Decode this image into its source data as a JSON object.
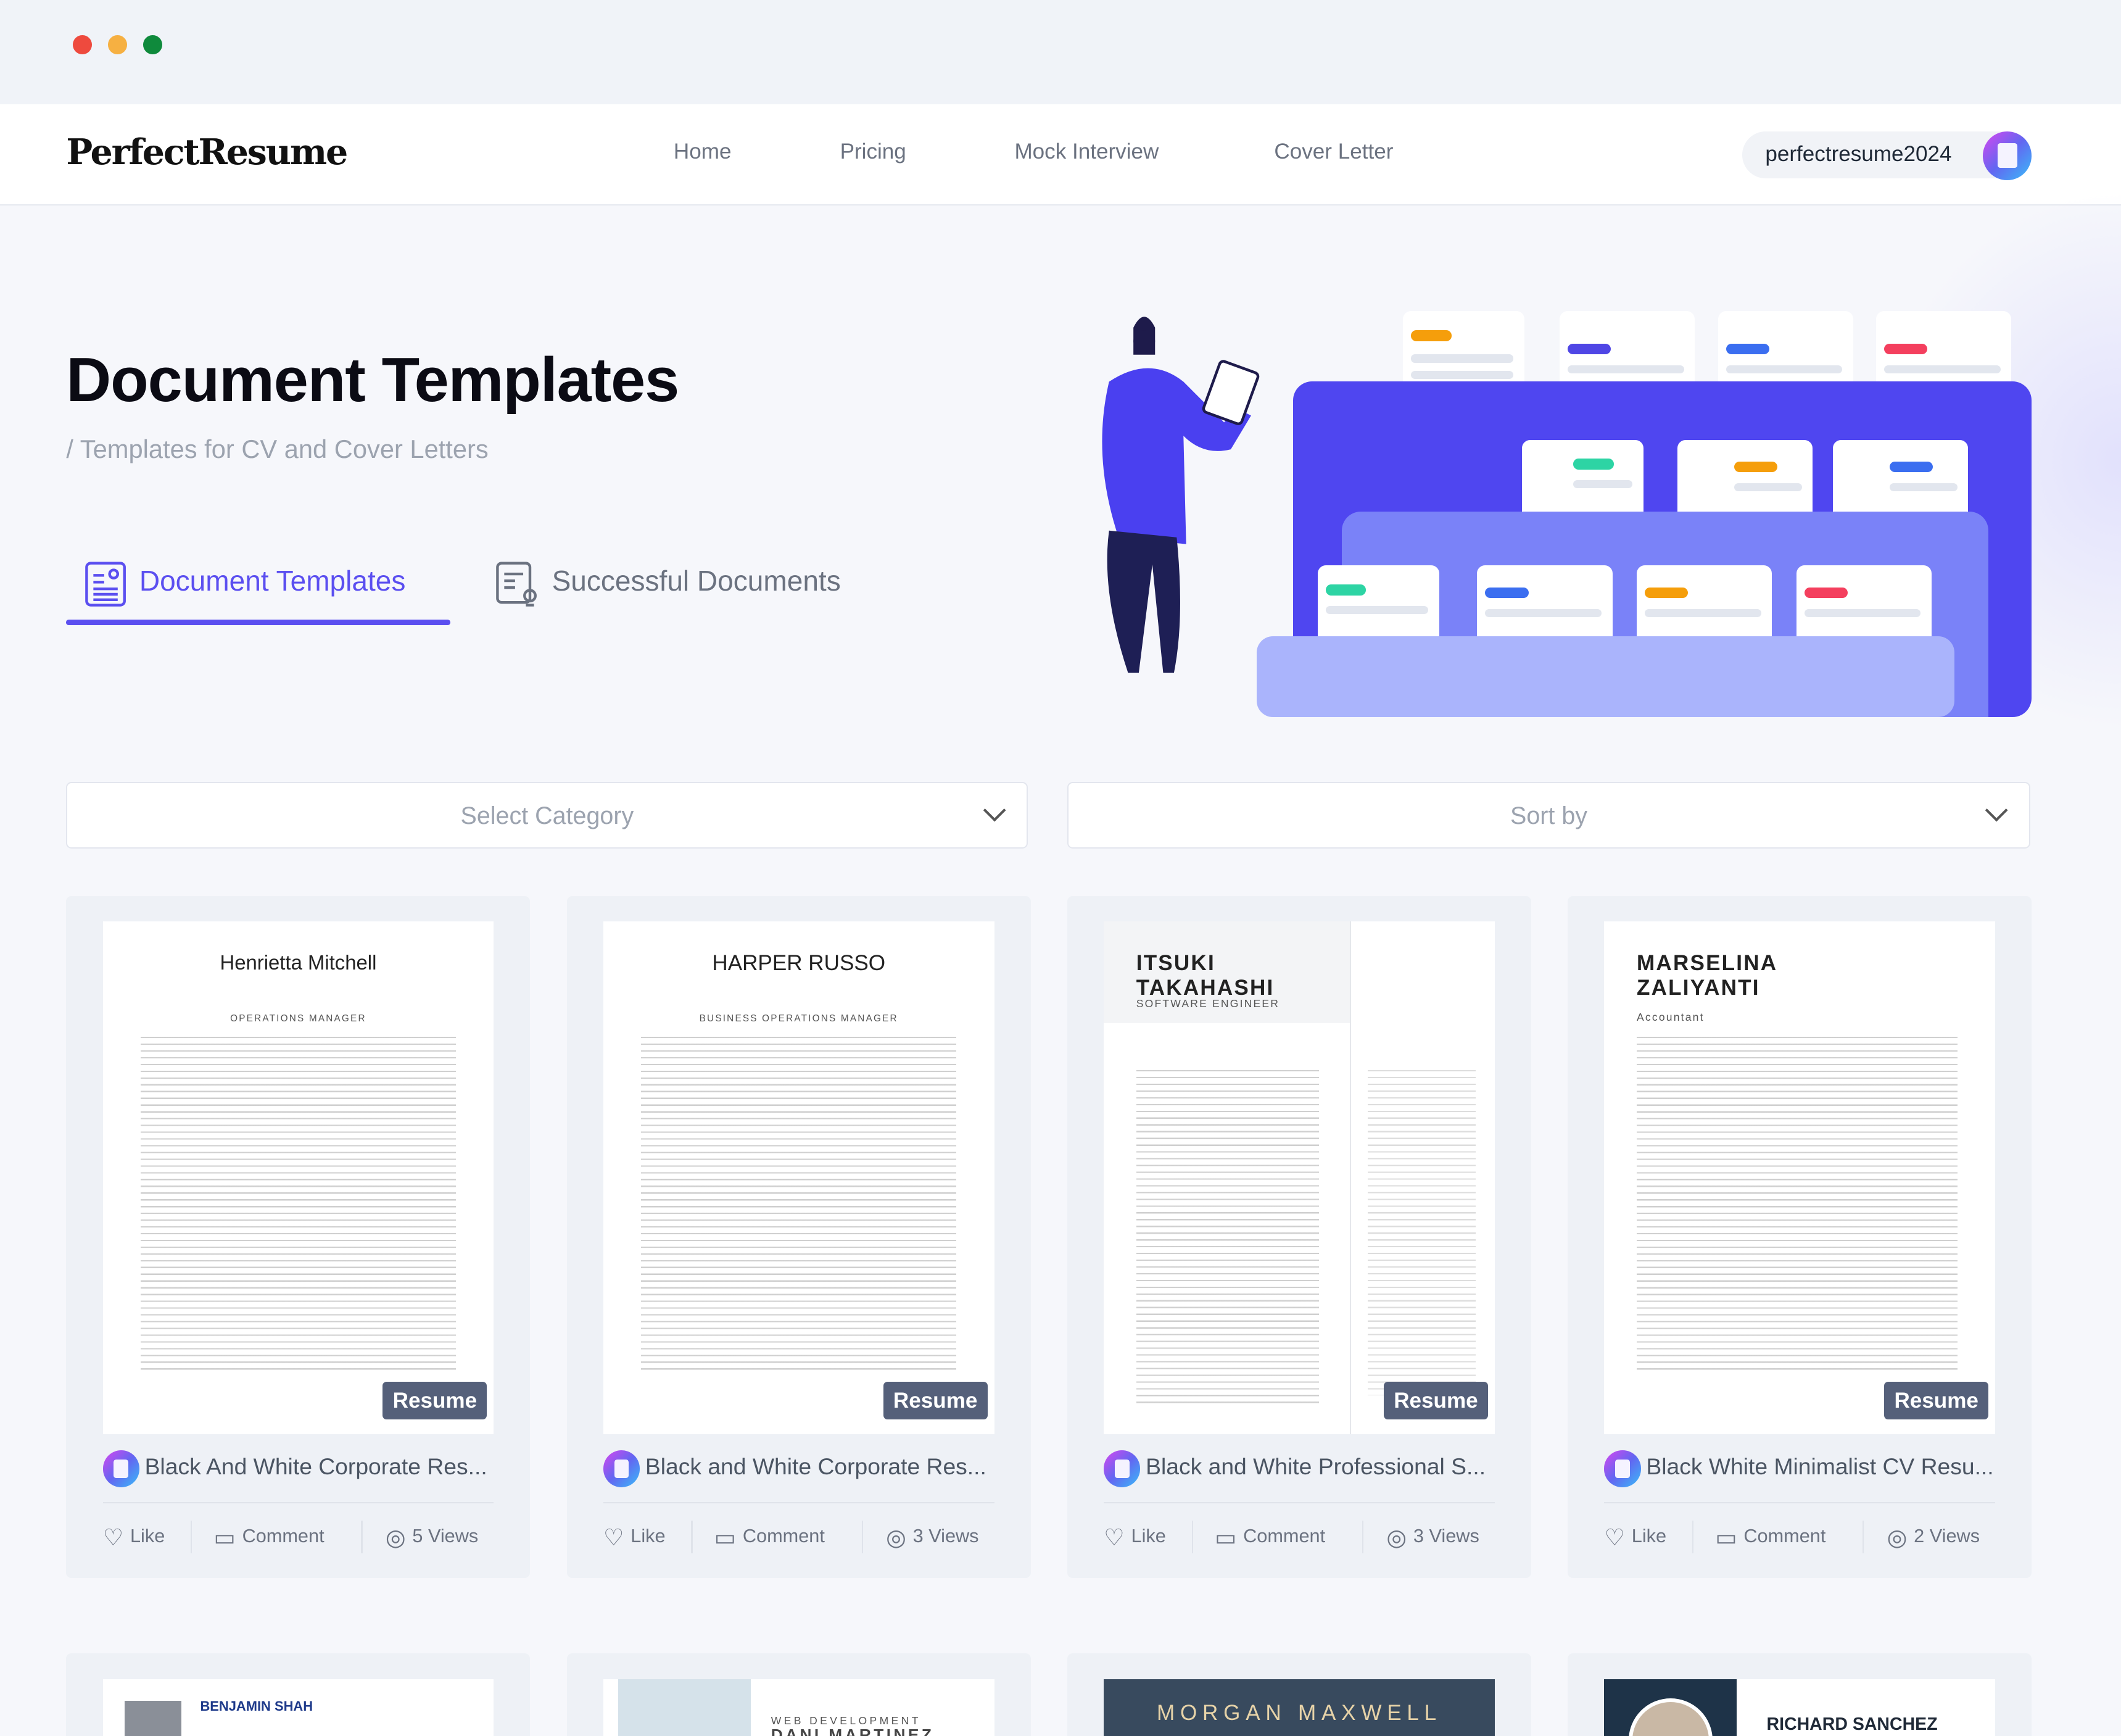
{
  "window": {
    "controls": [
      "close",
      "minimize",
      "maximize"
    ],
    "colors": {
      "close": "#ee4a3e",
      "minimize": "#f6b042",
      "maximize": "#0f8a3c"
    }
  },
  "nav": {
    "logo": "PerfectResume",
    "links": [
      "Home",
      "Pricing",
      "Mock Interview",
      "Cover Letter"
    ],
    "user": "perfectresume2024"
  },
  "hero": {
    "title": "Document Templates",
    "subtitle": "/ Templates for CV and Cover Letters"
  },
  "tabs": [
    {
      "label": "Document Templates",
      "active": true,
      "icon": "document-icon"
    },
    {
      "label": "Successful Documents",
      "active": false,
      "icon": "document-search-icon"
    }
  ],
  "filters": {
    "category": "Select Category",
    "sort": "Sort by"
  },
  "accent": "#5b4ff0",
  "cards": [
    {
      "title": "Black And White Corporate Res...",
      "badge": "Resume",
      "preview_name": "Henrietta Mitchell",
      "preview_role": "OPERATIONS MANAGER",
      "like": "Like",
      "comment": "Comment",
      "views": "5 Views"
    },
    {
      "title": "Black and White Corporate Res...",
      "badge": "Resume",
      "preview_name": "HARPER RUSSO",
      "preview_role": "BUSINESS OPERATIONS MANAGER",
      "like": "Like",
      "comment": "Comment",
      "views": "3 Views"
    },
    {
      "title": "Black and White Professional S...",
      "badge": "Resume",
      "preview_name": "ITSUKI TAKAHASHI",
      "preview_role": "SOFTWARE ENGINEER",
      "like": "Like",
      "comment": "Comment",
      "views": "3 Views"
    },
    {
      "title": "Black White Minimalist CV Resu...",
      "badge": "Resume",
      "preview_name": "MARSELINA ZALIYANTI",
      "preview_role": "Accountant",
      "like": "Like",
      "comment": "Comment",
      "views": "2 Views"
    }
  ],
  "cards_row2": [
    {
      "preview_name": "BENJAMIN SHAH"
    },
    {
      "preview_name": "DANI MARTINEZ",
      "preview_role": "WEB DEVELOPMENT"
    },
    {
      "preview_name": "MORGAN MAXWELL"
    },
    {
      "preview_name": "RICHARD SANCHEZ"
    }
  ]
}
